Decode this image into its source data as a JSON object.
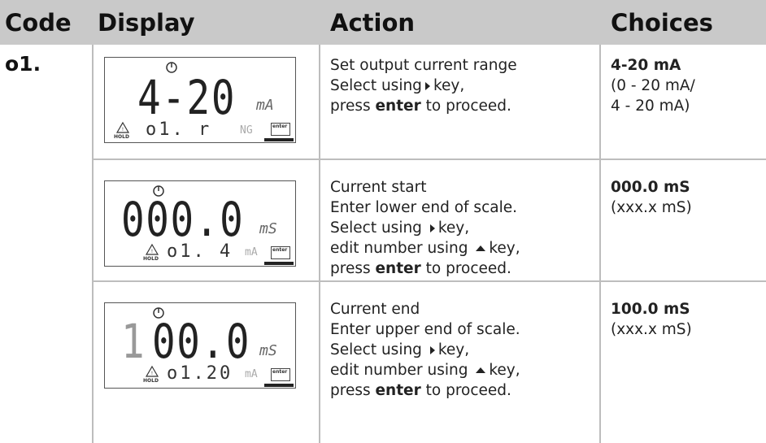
{
  "header": {
    "code": "Code",
    "display": "Display",
    "action": "Action",
    "choices": "Choices"
  },
  "rows": [
    {
      "code": "o1.",
      "display": {
        "main": "4-20",
        "unit": "mA",
        "sub": "o1. r",
        "sub_dim": "NG",
        "hold": "HOLD",
        "enter": "enter"
      },
      "action": {
        "l1": "Set output current range",
        "l2a": "Select using",
        "l2b": "key,",
        "l3a": "press",
        "l3b": "enter",
        "l3c": "to proceed."
      },
      "choices": {
        "strong": "4-20 mA",
        "l2": "(0 - 20 mA/",
        "l3": "4 - 20 mA)"
      }
    },
    {
      "code": "",
      "display": {
        "main": "000.0",
        "unit": "mS",
        "sub": "o1. 4",
        "sub_dim": "mA",
        "hold": "HOLD",
        "enter": "enter"
      },
      "action": {
        "l1": "Current start",
        "l2": "Enter lower end of scale.",
        "l3a": "Select using",
        "l3b": "key,",
        "l4a": "edit number using",
        "l4b": "key,",
        "l5a": "press",
        "l5b": "enter",
        "l5c": "to proceed."
      },
      "choices": {
        "strong": "000.0 mS",
        "l2": "(xxx.x mS)"
      }
    },
    {
      "code": "",
      "display": {
        "main_dim": "1",
        "main": "00.0",
        "unit": "mS",
        "sub": "o1.20",
        "sub_dim": "mA",
        "hold": "HOLD",
        "enter": "enter"
      },
      "action": {
        "l1": "Current end",
        "l2": "Enter upper end of scale.",
        "l3a": "Select using",
        "l3b": "key,",
        "l4a": "edit number using",
        "l4b": "key,",
        "l5a": "press",
        "l5b": "enter",
        "l5c": "to proceed."
      },
      "choices": {
        "strong": "100.0 mS",
        "l2": "(xxx.x mS)"
      }
    }
  ]
}
